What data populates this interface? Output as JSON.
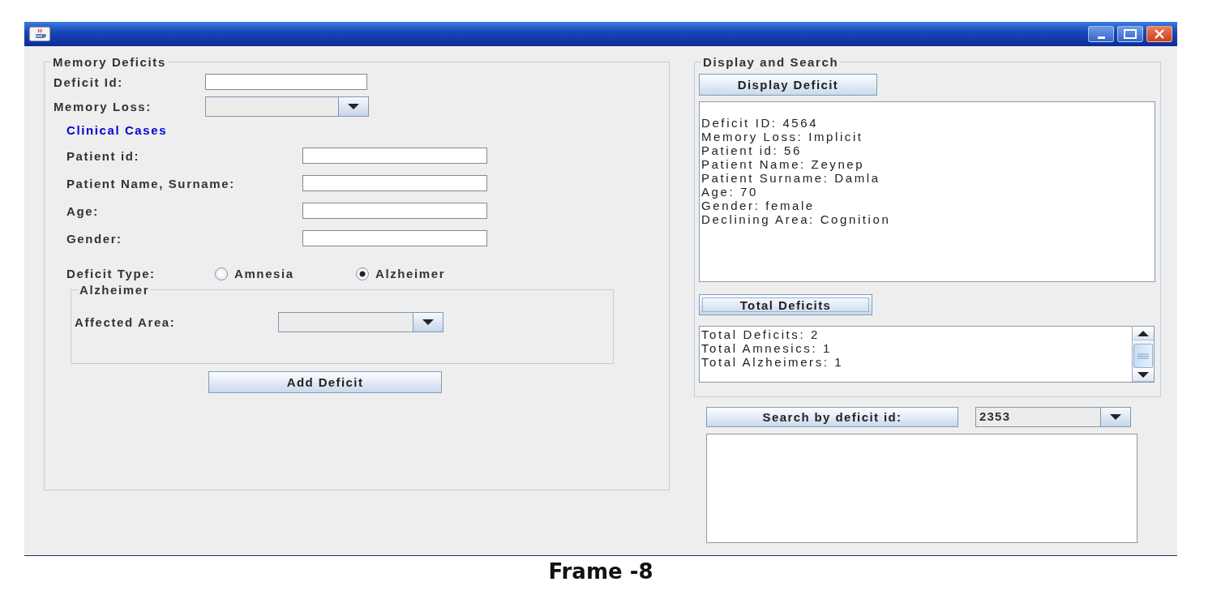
{
  "memory_deficits": {
    "title": "Memory Deficits",
    "fields": [
      {
        "label": "Deficit Id:",
        "kind": "text"
      },
      {
        "label": "Memory Loss:",
        "kind": "combo"
      }
    ],
    "clinical_cases": {
      "title": "Clinical Cases",
      "fields": [
        {
          "label": "Patient id:"
        },
        {
          "label": "Patient Name, Surname:"
        },
        {
          "label": "Age:"
        },
        {
          "label": "Gender:"
        }
      ]
    },
    "deficit_type": {
      "label": "Deficit Type:",
      "options": [
        {
          "label": "Amnesia",
          "selected": false
        },
        {
          "label": "Alzheimer",
          "selected": true
        }
      ]
    },
    "alzheimer": {
      "title": "Alzheimer",
      "affected_area_label": "Affected Area:"
    },
    "add_button": {
      "label": "Add Deficit",
      "focused": false
    }
  },
  "display_and_search": {
    "title": "Display and Search",
    "display_button": {
      "label": "Display Deficit",
      "focused": false
    },
    "display_output": [
      "Deficit ID: 4564",
      "Memory Loss: Implicit",
      "Patient id: 56",
      "Patient Name: Zeynep",
      "Patient Surname: Damla",
      "Age: 70",
      "Gender: female",
      "Declining Area: Cognition"
    ],
    "total_button": {
      "label": "Total Deficits",
      "focused": true
    },
    "total_output": [
      "Total Deficits: 2",
      "Total Amnesics: 1",
      "Total Alzheimers: 1"
    ]
  },
  "search": {
    "button": {
      "label": "Search by deficit id:",
      "focused": false
    },
    "combo_value": "2353"
  },
  "caption": "Frame -8"
}
